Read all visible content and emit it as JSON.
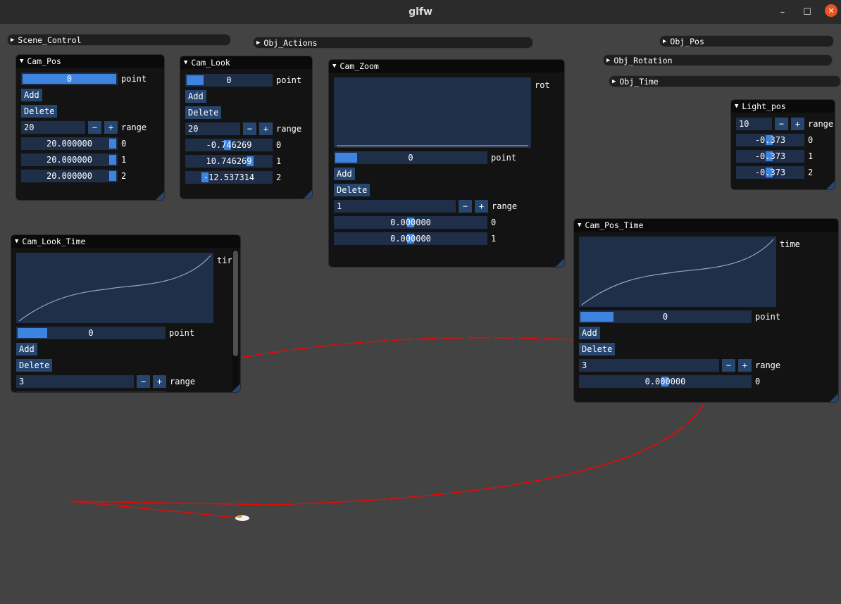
{
  "window": {
    "title": "glfw",
    "minimize": "–",
    "maximize": "☐",
    "close": "✕"
  },
  "collapsed": {
    "scene_control": "Scene_Control",
    "obj_actions": "Obj_Actions",
    "obj_pos": "Obj_Pos",
    "obj_rotation": "Obj_Rotation",
    "obj_time": "Obj_Time"
  },
  "common": {
    "add": "Add",
    "delete": "Delete",
    "minus": "−",
    "plus": "+",
    "range": "range",
    "point": "point",
    "i0": "0",
    "i1": "1",
    "i2": "2"
  },
  "cam_pos": {
    "title": "Cam_Pos",
    "point": "0",
    "point_fill": 1.0,
    "range": "20",
    "values": [
      "20.000000",
      "20.000000",
      "20.000000"
    ]
  },
  "cam_look": {
    "title": "Cam_Look",
    "point": "0",
    "point_fill": 0.2,
    "range": "20",
    "values": [
      "-0.746269",
      "10.746269",
      "-12.537314"
    ]
  },
  "cam_zoom": {
    "title": "Cam_Zoom",
    "plot_label": "rot",
    "point": "0",
    "point_fill": 0.15,
    "range": "1",
    "values": [
      "0.000000",
      "0.000000"
    ]
  },
  "light_pos": {
    "title": "Light_pos",
    "range": "10",
    "values": [
      "-0.373",
      "-0.373",
      "-0.373"
    ]
  },
  "cam_pos_time": {
    "title": "Cam_Pos_Time",
    "plot_label": "time",
    "point": "0",
    "point_fill": 0.2,
    "range": "3",
    "values": [
      "0.000000"
    ]
  },
  "cam_look_time": {
    "title": "Cam_Look_Time",
    "plot_label": "tir",
    "point": "0",
    "point_fill": 0.15,
    "range": "3"
  }
}
